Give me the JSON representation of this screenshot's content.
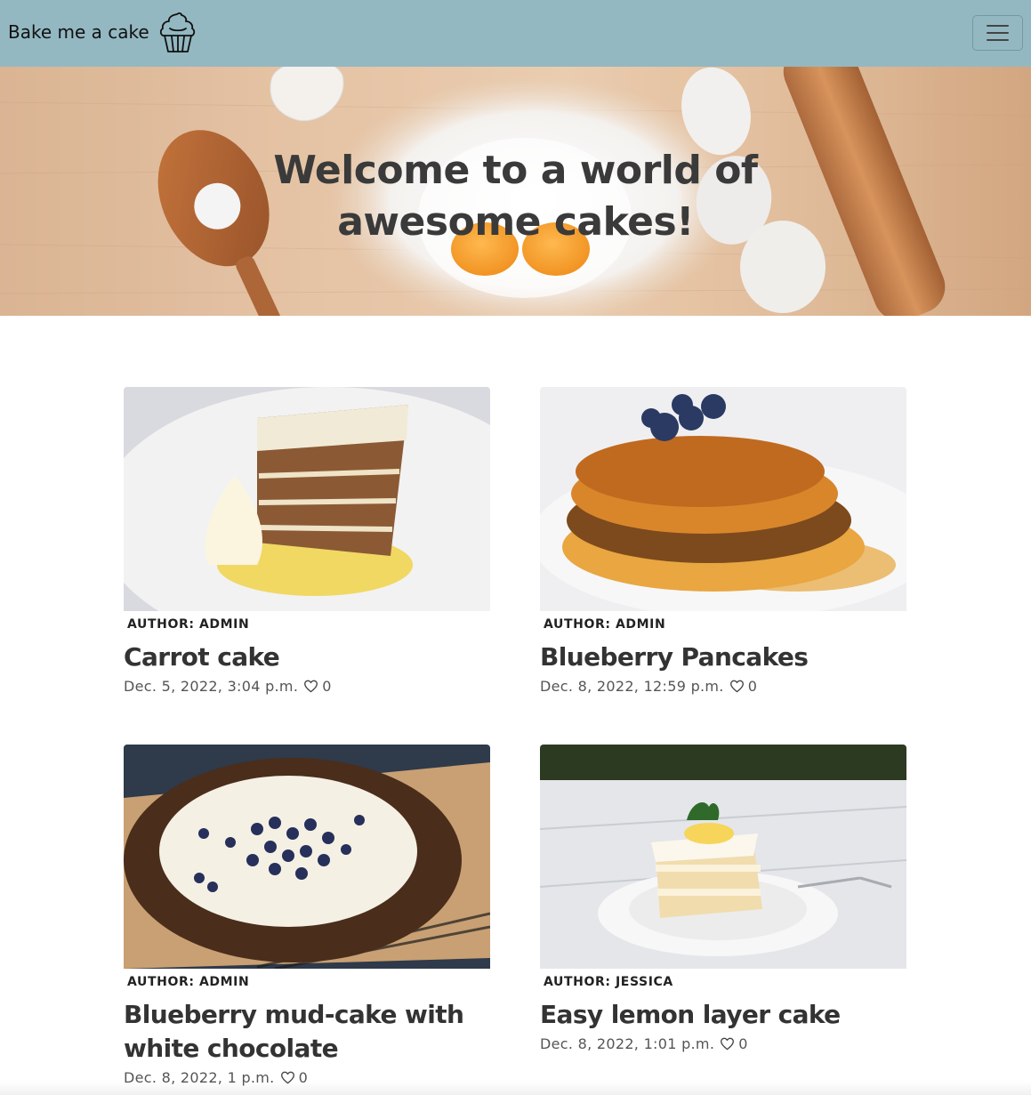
{
  "navbar": {
    "brand_text": "Bake me a cake",
    "logo_icon": "cupcake-icon",
    "menu_icon": "hamburger-menu-icon",
    "background_color": "#93b8c2"
  },
  "hero": {
    "title_line1": "Welcome to a world of",
    "title_line2": "awesome cakes!"
  },
  "posts": [
    {
      "author": "AUTHOR: ADMIN",
      "title": "Carrot cake",
      "date": "Dec. 5, 2022, 3:04 p.m.",
      "likes": "0",
      "image": "carrot-cake-slice-photo"
    },
    {
      "author": "AUTHOR: ADMIN",
      "title": "Blueberry Pancakes",
      "date": "Dec. 8, 2022, 12:59 p.m.",
      "likes": "0",
      "image": "blueberry-pancakes-photo"
    },
    {
      "author": "AUTHOR: ADMIN",
      "title": "Blueberry mud-cake with white chocolate",
      "date": "Dec. 8, 2022, 1 p.m.",
      "likes": "0",
      "image": "blueberry-mud-cake-photo"
    },
    {
      "author": "AUTHOR: JESSICA",
      "title": "Easy lemon layer cake",
      "date": "Dec. 8, 2022, 1:01 p.m.",
      "likes": "0",
      "image": "lemon-layer-cake-photo"
    }
  ]
}
